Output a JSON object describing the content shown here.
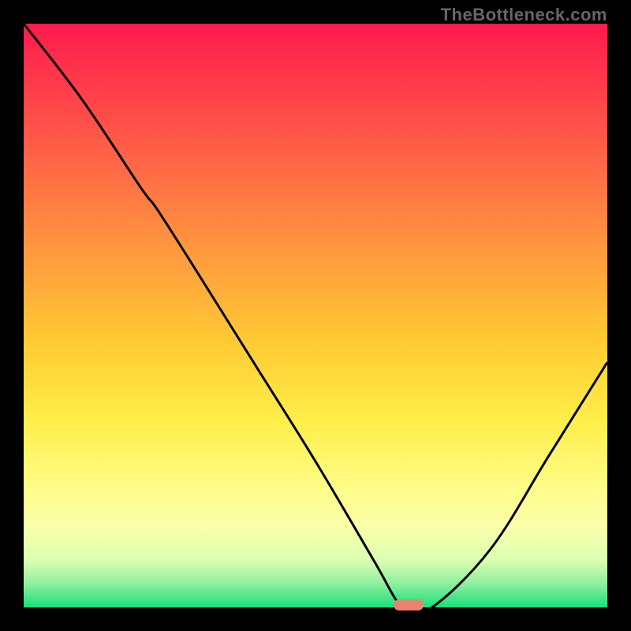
{
  "attribution": "TheBottleneck.com",
  "colors": {
    "curve": "#000000",
    "marker": "#e9836f",
    "gradient_top": "#ff1a4d",
    "gradient_bottom": "#18e07a"
  },
  "chart_data": {
    "type": "line",
    "title": "",
    "xlabel": "",
    "ylabel": "",
    "xlim": [
      0,
      100
    ],
    "ylim": [
      0,
      100
    ],
    "x": [
      0,
      10,
      20,
      23,
      30,
      40,
      50,
      60,
      64,
      66,
      70,
      80,
      90,
      100
    ],
    "values": [
      100,
      87,
      72,
      68,
      57,
      41,
      25,
      8,
      1,
      0,
      0,
      10,
      26,
      42
    ],
    "marker": {
      "x": 66,
      "y": 0
    }
  }
}
